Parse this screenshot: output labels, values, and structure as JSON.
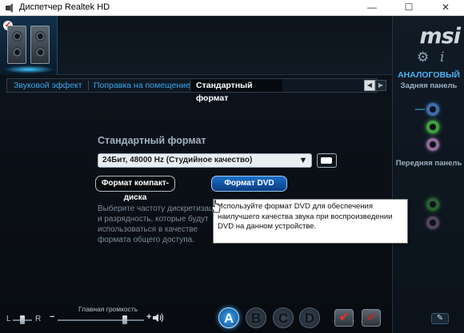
{
  "window": {
    "title": "Диспетчер Realtek HD",
    "minimize_glyph": "—",
    "maximize_glyph": "☐",
    "close_glyph": "✕"
  },
  "right_panel": {
    "logo": "msi",
    "mode_label": "АНАЛОГОВЫЙ",
    "rear_panel_label": "Задняя панель",
    "front_panel_label": "Передняя панель",
    "wrench_glyph": "✎"
  },
  "tabs": [
    {
      "label": "Звуковой эффект",
      "active": false
    },
    {
      "label": "Поправка на помещение",
      "active": false
    },
    {
      "label": "Стандартный формат",
      "active": true
    }
  ],
  "tab_nav": {
    "prev": "◀",
    "next": "▶"
  },
  "format": {
    "section_title": "Стандартный формат",
    "selected": "24Бит, 48000 Hz (Студийное качество)",
    "arrow": "▼",
    "cd_button": "Формат компакт-диска",
    "dvd_button": "Формат DVD",
    "description": "Выберите частоту дискретизации и разрядность, которые будут использоваться в качестве формата общего доступа."
  },
  "tooltip": {
    "text": "Используйте формат DVD для обеспечения наилучшего качества звука при воспроизведении DVD на данном устройстве."
  },
  "volume": {
    "title": "Главная громкость",
    "balance_left": "L",
    "balance_right": "R",
    "balance_value": 0.5,
    "level_value": 0.78,
    "minus": "−",
    "plus": "+"
  },
  "profiles": [
    {
      "label": "A",
      "active": true
    },
    {
      "label": "B",
      "active": false
    },
    {
      "label": "C",
      "active": false
    },
    {
      "label": "D",
      "active": false
    }
  ],
  "actions": {
    "ok_glyph": "✔",
    "cancel_glyph": "✔"
  },
  "colors": {
    "accent": "#3aa7ec",
    "tab_active_text": "#ffffff",
    "jack_green": "#3f9f3f",
    "jack_blue": "#3d6ea8",
    "jack_pink": "#8d6b9b"
  }
}
